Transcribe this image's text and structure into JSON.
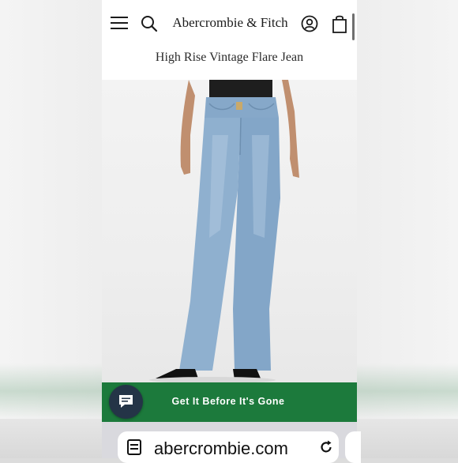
{
  "header": {
    "brand": "Abercrombie & Fitch",
    "menu_icon": "hamburger-menu-icon",
    "search_icon": "search-icon",
    "account_icon": "account-icon",
    "bag_icon": "shopping-bag-icon"
  },
  "product": {
    "title": "High Rise Vintage Flare Jean"
  },
  "cta": {
    "label": "Get It Before It's Gone",
    "chat_icon": "chat-icon"
  },
  "browser": {
    "url": "abercrombie.com",
    "reader_icon": "reader-mode-icon",
    "reload_icon": "reload-icon"
  },
  "colors": {
    "cta_green": "#1c7a3c",
    "chat_navy": "#243447",
    "denim": "#8fb0cf"
  }
}
